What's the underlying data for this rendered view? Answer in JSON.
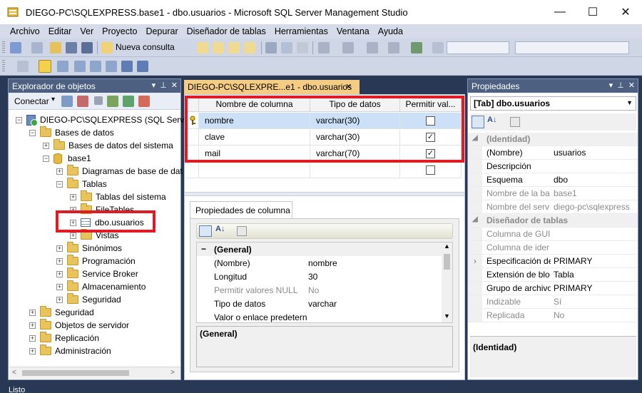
{
  "window": {
    "title": "DIEGO-PC\\SQLEXPRESS.base1 - dbo.usuarios - Microsoft SQL Server Management Studio",
    "minimize": "—",
    "maximize": "☐",
    "close": "✕"
  },
  "menu": [
    "Archivo",
    "Editar",
    "Ver",
    "Proyecto",
    "Depurar",
    "Diseñador de tablas",
    "Herramientas",
    "Ventana",
    "Ayuda"
  ],
  "toolbar": {
    "new_query": "Nueva consulta"
  },
  "object_explorer": {
    "title": "Explorador de objetos",
    "connect_label": "Conectar",
    "tree": [
      {
        "label": "DIEGO-PC\\SQLEXPRESS (SQL Server",
        "expander": "−",
        "icon": "server-icon"
      },
      {
        "label": "Bases de datos",
        "expander": "−",
        "icon": "folder-icon"
      },
      {
        "label": "Bases de datos del sistema",
        "expander": "+",
        "icon": "folder-icon"
      },
      {
        "label": "base1",
        "expander": "−",
        "icon": "database-icon"
      },
      {
        "label": "Diagramas de base de dat",
        "expander": "+",
        "icon": "folder-icon"
      },
      {
        "label": "Tablas",
        "expander": "−",
        "icon": "folder-icon"
      },
      {
        "label": "Tablas del sistema",
        "expander": "+",
        "icon": "folder-icon"
      },
      {
        "label": "FileTables",
        "expander": "+",
        "icon": "folder-icon"
      },
      {
        "label": "dbo.usuarios",
        "expander": "+",
        "icon": "table-icon"
      },
      {
        "label": "Vistas",
        "expander": "+",
        "icon": "folder-icon"
      },
      {
        "label": "Sinónimos",
        "expander": "+",
        "icon": "folder-icon"
      },
      {
        "label": "Programación",
        "expander": "+",
        "icon": "folder-icon"
      },
      {
        "label": "Service Broker",
        "expander": "+",
        "icon": "folder-icon"
      },
      {
        "label": "Almacenamiento",
        "expander": "+",
        "icon": "folder-icon"
      },
      {
        "label": "Seguridad",
        "expander": "+",
        "icon": "folder-icon"
      },
      {
        "label": "Seguridad",
        "expander": "+",
        "icon": "folder-icon"
      },
      {
        "label": "Objetos de servidor",
        "expander": "+",
        "icon": "folder-icon"
      },
      {
        "label": "Replicación",
        "expander": "+",
        "icon": "folder-icon"
      },
      {
        "label": "Administración",
        "expander": "+",
        "icon": "folder-icon"
      }
    ]
  },
  "document": {
    "tab_title": "DIEGO-PC\\SQLEXPRE...e1 - dbo.usuarios",
    "tab_close": "✕",
    "grid": {
      "headers": [
        "Nombre de columna",
        "Tipo de datos",
        "Permitir val..."
      ],
      "rows": [
        {
          "name": "nombre",
          "type": "varchar(30)",
          "nulls": "",
          "key": true
        },
        {
          "name": "clave",
          "type": "varchar(30)",
          "nulls": "✓",
          "key": false
        },
        {
          "name": "mail",
          "type": "varchar(70)",
          "nulls": "✓",
          "key": false
        }
      ],
      "empty_row_null": ""
    },
    "column_properties": {
      "tab_label": "Propiedades de columna",
      "category": "(General)",
      "rows": [
        {
          "name": "(Nombre)",
          "value": "nombre",
          "disabled": false
        },
        {
          "name": "Longitud",
          "value": "30",
          "disabled": false
        },
        {
          "name": "Permitir valores NULL",
          "value": "No",
          "disabled": true
        },
        {
          "name": "Tipo de datos",
          "value": "varchar",
          "disabled": false
        },
        {
          "name": "Valor o enlace predetern",
          "value": "",
          "disabled": false
        }
      ],
      "description_title": "(General)"
    }
  },
  "properties": {
    "title": "Propiedades",
    "selected_object": "[Tab] dbo.usuarios",
    "rows": [
      {
        "type": "cat",
        "name": "(Identidad)"
      },
      {
        "type": "prop",
        "name": "(Nombre)",
        "value": "usuarios",
        "disabled": false
      },
      {
        "type": "prop",
        "name": "Descripción",
        "value": "",
        "disabled": false
      },
      {
        "type": "prop",
        "name": "Esquema",
        "value": "dbo",
        "disabled": false
      },
      {
        "type": "prop",
        "name": "Nombre de la ba",
        "value": "base1",
        "disabled": true
      },
      {
        "type": "prop",
        "name": "Nombre del serv",
        "value": "diego-pc\\sqlexpress",
        "disabled": true
      },
      {
        "type": "cat",
        "name": "Diseñador de tablas"
      },
      {
        "type": "prop",
        "name": "Columna de GUI",
        "value": "",
        "disabled": true
      },
      {
        "type": "prop",
        "name": "Columna de ider",
        "value": "",
        "disabled": true
      },
      {
        "type": "prop",
        "name": "Especificación de",
        "value": "PRIMARY",
        "disabled": false,
        "expandable": true
      },
      {
        "type": "prop",
        "name": "Extensión de blo",
        "value": "Tabla",
        "disabled": false
      },
      {
        "type": "prop",
        "name": "Grupo de archivo",
        "value": "PRIMARY",
        "disabled": false
      },
      {
        "type": "prop",
        "name": "Indizable",
        "value": "Sí",
        "disabled": true
      },
      {
        "type": "prop",
        "name": "Replicada",
        "value": "No",
        "disabled": true
      }
    ],
    "description_title": "(Identidad)"
  },
  "status": {
    "text": "Listo"
  },
  "colors": {
    "accent": "#f5cc84",
    "highlight": "#e01b24",
    "chrome": "#293955",
    "panel_header": "#4d6082"
  }
}
